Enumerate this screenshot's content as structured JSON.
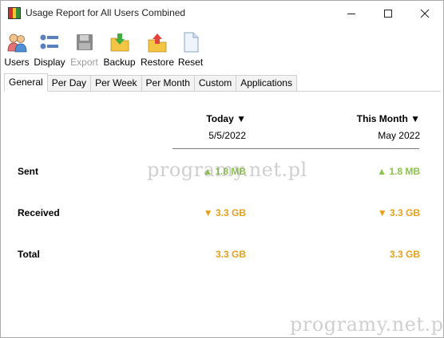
{
  "window": {
    "title": "Usage Report for All Users Combined"
  },
  "toolbar": {
    "users": "Users",
    "display": "Display",
    "export": "Export",
    "backup": "Backup",
    "restore": "Restore",
    "reset": "Reset"
  },
  "tabs": [
    "General",
    "Per Day",
    "Per Week",
    "Per Month",
    "Custom",
    "Applications"
  ],
  "report": {
    "columns": [
      {
        "heading": "Today ▼",
        "date": "5/5/2022"
      },
      {
        "heading": "This Month ▼",
        "date": "May 2022"
      }
    ],
    "rows": [
      {
        "label": "Sent",
        "today": "▲ 1.8 MB",
        "month": "▲ 1.8 MB"
      },
      {
        "label": "Received",
        "today": "▼ 3.3 GB",
        "month": "▼ 3.3 GB"
      },
      {
        "label": "Total",
        "today": "3.3 GB",
        "month": "3.3 GB"
      }
    ]
  },
  "watermark": "programy.net.pl",
  "colors": {
    "sent": "#8bc34a",
    "received": "#e6a11c",
    "total": "#e6a11c"
  }
}
